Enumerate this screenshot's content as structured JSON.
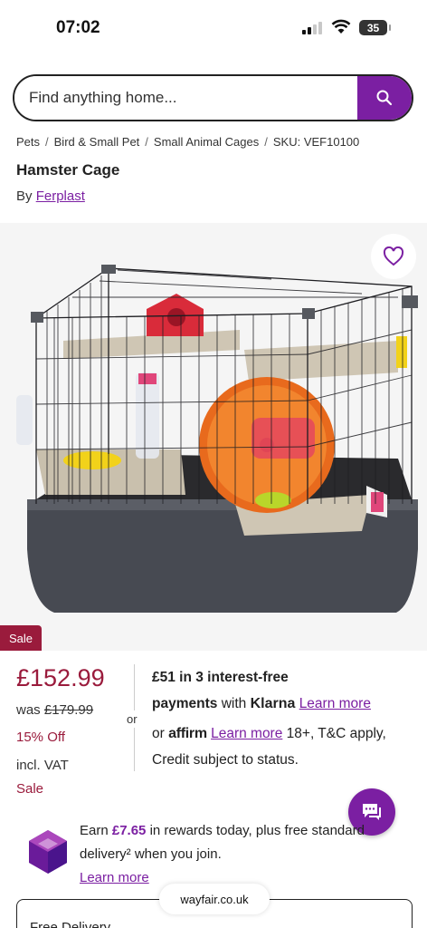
{
  "status_bar": {
    "time": "07:02",
    "battery": "35"
  },
  "search": {
    "placeholder": "Find anything home..."
  },
  "breadcrumb": {
    "items": [
      "Pets",
      "Bird & Small Pet",
      "Small Animal Cages"
    ],
    "sku": "SKU: VEF10100"
  },
  "product": {
    "title": "Hamster Cage",
    "by_label": "By",
    "brand": "Ferplast"
  },
  "gallery": {
    "image": "hamster-cage-product-photo"
  },
  "pricing": {
    "sale_tag": "Sale",
    "price": "£152.99",
    "was_label": "was",
    "was_price": "£179.99",
    "discount": "15% Off",
    "vat": "incl. VAT",
    "sale_label": "Sale"
  },
  "finance": {
    "or": "or",
    "klarna_amount": "£51 in 3 interest-free",
    "klarna_payments": "payments",
    "klarna_with": "with",
    "klarna_brand": "Klarna",
    "learn_more": "Learn more",
    "affirm_or": "or",
    "affirm_brand": "affirm",
    "affirm_learn_more": "Learn more",
    "affirm_terms": "18+, T&C apply, Credit subject to status."
  },
  "rewards": {
    "earn": "Earn",
    "amount": "£7.65",
    "text_after": "in rewards today, plus free standard delivery² when you join.",
    "learn_more": "Learn more"
  },
  "browser": {
    "domain": "wayfair.co.uk"
  },
  "delivery": {
    "label": "Free Delivery"
  },
  "colors": {
    "accent": "#7b1fa2",
    "sale": "#9a1b3c"
  }
}
